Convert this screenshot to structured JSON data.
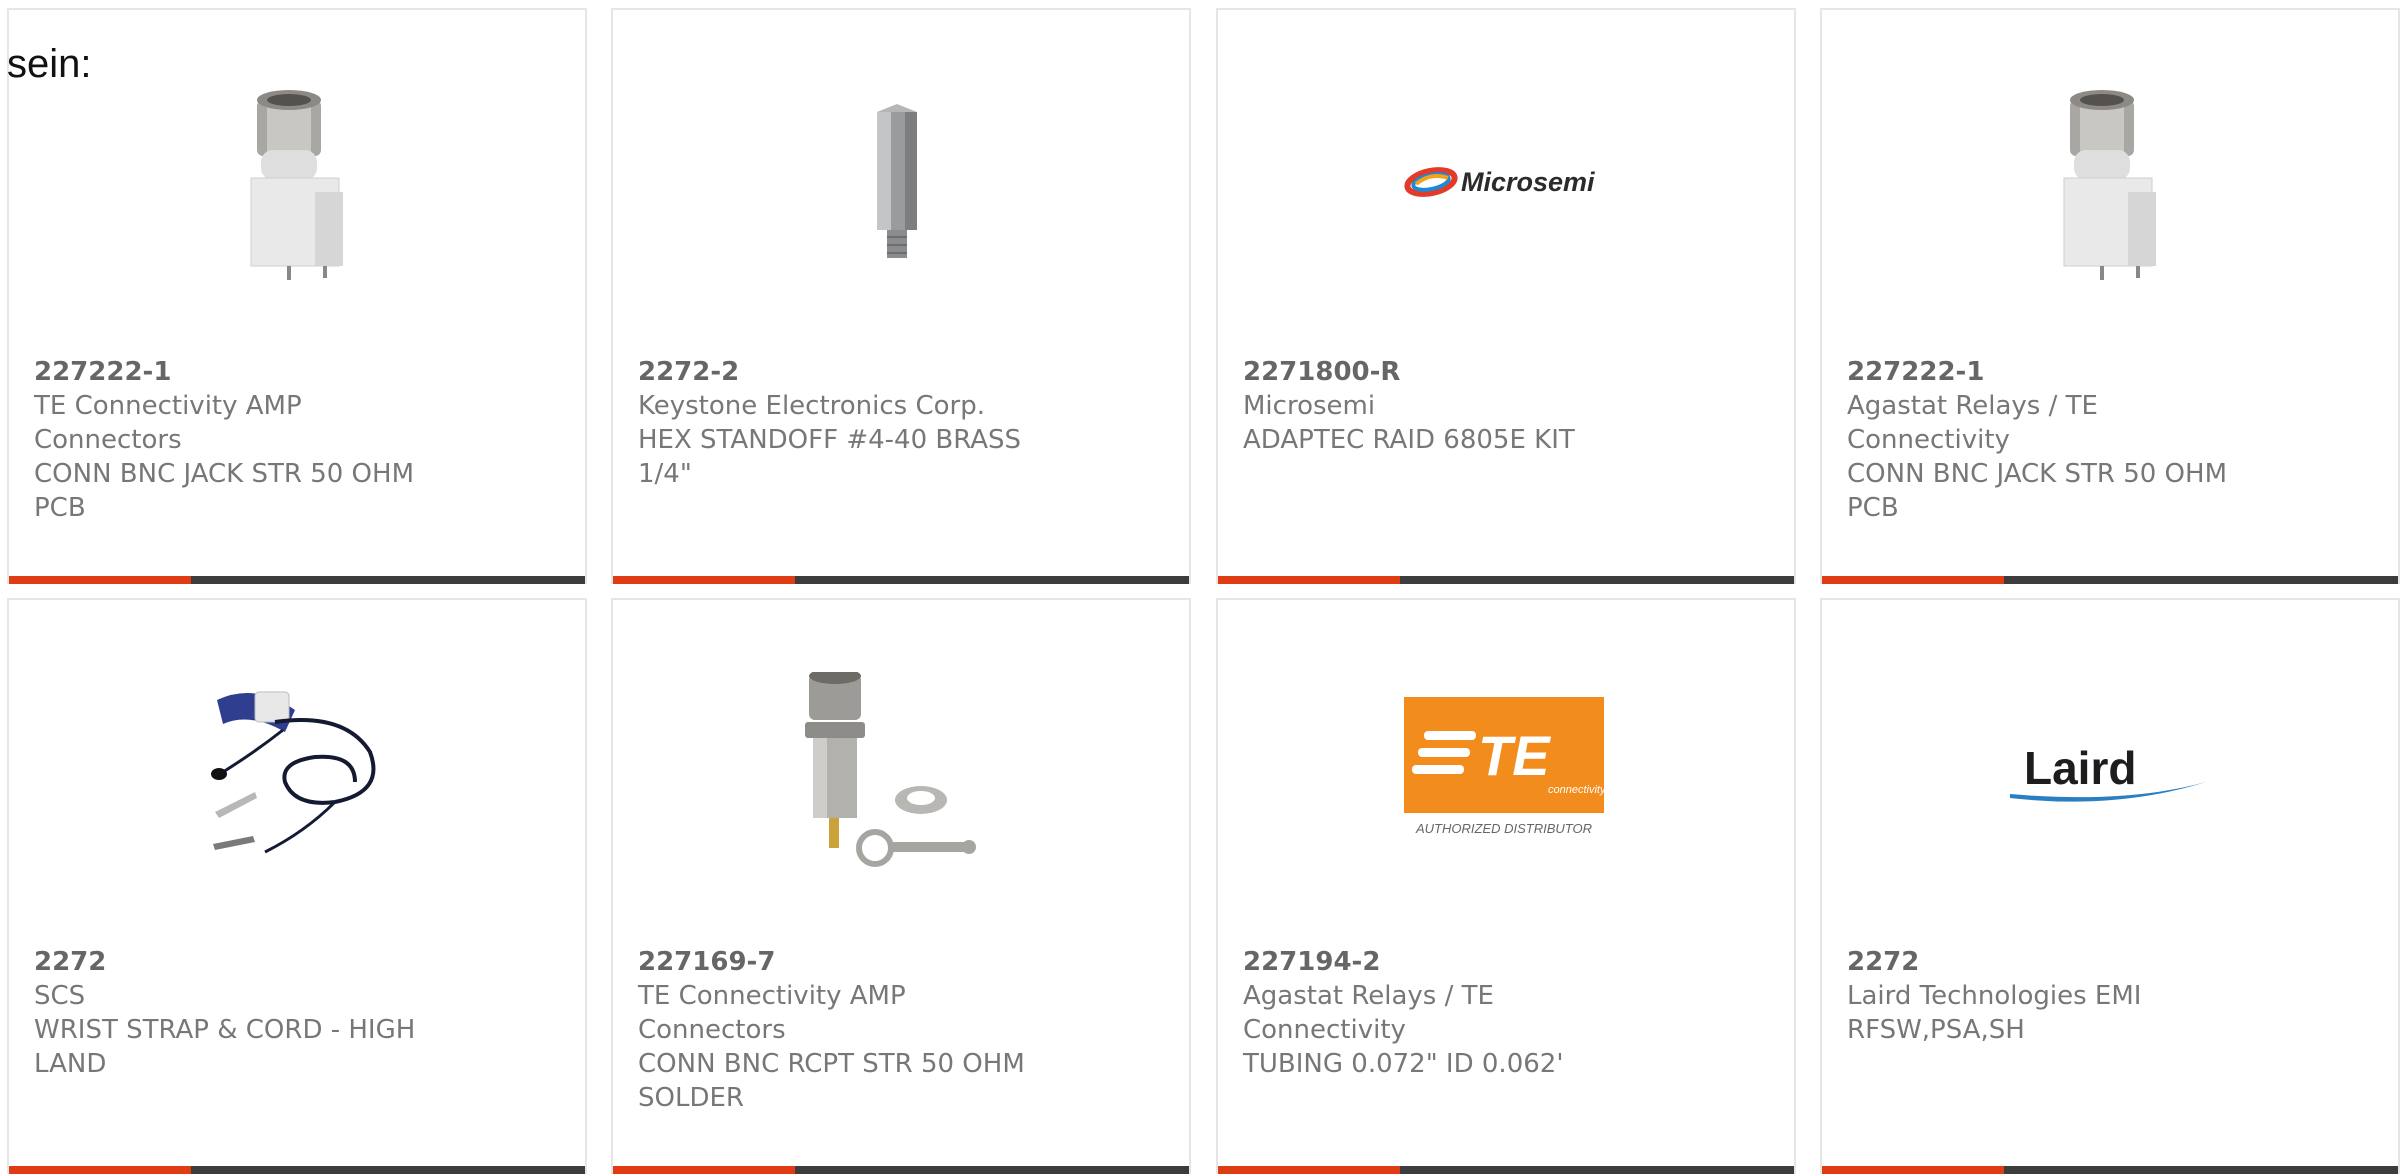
{
  "page": {
    "intro_text": "sein:"
  },
  "accent_color": "#e03c14",
  "bar_color": "#3c3c3c",
  "cards": [
    {
      "part_number": "227222-1",
      "manufacturer": "TE Connectivity AMP Connectors",
      "desc1": "CONN BNC JACK STR 50 OHM",
      "desc2": "PCB",
      "image": "bnc-jack-photo"
    },
    {
      "part_number": "2272-2",
      "manufacturer": "Keystone Electronics Corp.",
      "desc1": "HEX STANDOFF #4-40 BRASS",
      "desc2": "1/4\"",
      "image": "hex-standoff-photo"
    },
    {
      "part_number": "2271800-R",
      "manufacturer": "Microsemi",
      "desc1": "ADAPTEC RAID 6805E KIT",
      "desc2": "",
      "image": "microsemi-logo",
      "logo_text": "Microsemi"
    },
    {
      "part_number": "227222-1",
      "manufacturer": "Agastat Relays / TE Connectivity",
      "desc1": "CONN BNC JACK STR 50 OHM",
      "desc2": "PCB",
      "image": "bnc-jack-photo"
    },
    {
      "part_number": "2272",
      "manufacturer": "SCS",
      "desc1": "WRIST STRAP & CORD - HIGH",
      "desc2": "LAND",
      "image": "wrist-strap-photo"
    },
    {
      "part_number": "227169-7",
      "manufacturer": "TE Connectivity AMP Connectors",
      "desc1": "CONN BNC RCPT STR 50 OHM",
      "desc2": "SOLDER",
      "image": "bnc-receptacle-photo"
    },
    {
      "part_number": "227194-2",
      "manufacturer": "Agastat Relays / TE Connectivity",
      "desc1": "TUBING 0.072\" ID 0.062'",
      "desc2": "",
      "image": "te-connectivity-logo",
      "logo_text": "TE",
      "logo_sub": "connectivity",
      "logo_caption": "AUTHORIZED DISTRIBUTOR"
    },
    {
      "part_number": "2272",
      "manufacturer": "Laird Technologies EMI",
      "desc1": "RFSW,PSA,SH",
      "desc2": "",
      "image": "laird-logo",
      "logo_text": "Laird"
    }
  ]
}
